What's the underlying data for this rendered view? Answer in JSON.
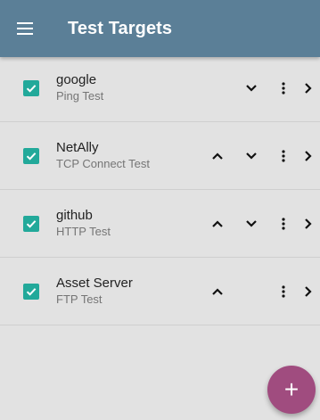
{
  "app_bar": {
    "title": "Test Targets",
    "menu_icon": "hamburger-menu-icon",
    "color": "#5b7f97"
  },
  "targets": [
    {
      "name": "google",
      "test_type": "Ping Test",
      "checked": true,
      "move_up": false,
      "move_down": true
    },
    {
      "name": "NetAlly",
      "test_type": "TCP Connect Test",
      "checked": true,
      "move_up": true,
      "move_down": true
    },
    {
      "name": "github",
      "test_type": "HTTP Test",
      "checked": true,
      "move_up": true,
      "move_down": true
    },
    {
      "name": "Asset Server",
      "test_type": "FTP Test",
      "checked": true,
      "move_up": true,
      "move_down": false
    }
  ],
  "row_icons": {
    "checkbox": "checkbox-checked-icon",
    "move_up": "chevron-up-icon",
    "move_down": "chevron-down-icon",
    "more": "more-vertical-icon",
    "open": "chevron-right-icon"
  },
  "fab": {
    "label": "+",
    "icon": "plus-icon"
  },
  "colors": {
    "checkbox": "#22a99a",
    "fab": "#a04c7f",
    "background": "#e2e2e2"
  }
}
